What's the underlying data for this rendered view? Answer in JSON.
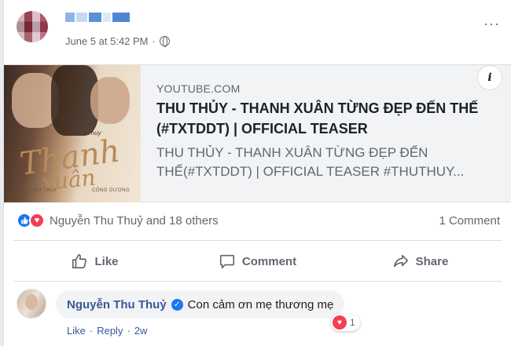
{
  "post": {
    "timestamp": "June 5 at 5:42 PM",
    "privacy_icon": "globe-icon",
    "more_icon": "more-options-icon",
    "more_glyph": "···"
  },
  "link_card": {
    "domain": "YOUTUBE.COM",
    "headline": "THU THỦY - THANH XUÂN TỪNG ĐẸP ĐẾN THẾ (#TXTDDT) | OFFICIAL TEASER",
    "description": "THU THỦY - THANH XUÂN TỪNG ĐẸP ĐẾN THẾ(#TXTDDT) | OFFICIAL TEASER #THUTHUY...",
    "info_glyph": "i",
    "thumbnail": {
      "script_line1": "Thanh",
      "script_line2": "xuân",
      "artist": "THU THUY",
      "credit": "CÔNG DƯƠNG",
      "signature": "ThuThuy"
    }
  },
  "reactions": {
    "summary": "Nguyễn Thu Thuỷ and 18 others",
    "comments_count": "1 Comment"
  },
  "actions": {
    "like": "Like",
    "comment": "Comment",
    "share": "Share"
  },
  "comment": {
    "author": "Nguyễn Thu Thuỷ",
    "text": "Con cảm ơn mẹ thương mẹ",
    "reaction_count": "1",
    "like": "Like",
    "reply": "Reply",
    "age": "2w",
    "sep": "·"
  },
  "colors": {
    "link_blue": "#385898",
    "like_blue": "#1877f2",
    "love_red": "#f33e58",
    "muted": "#606770"
  }
}
